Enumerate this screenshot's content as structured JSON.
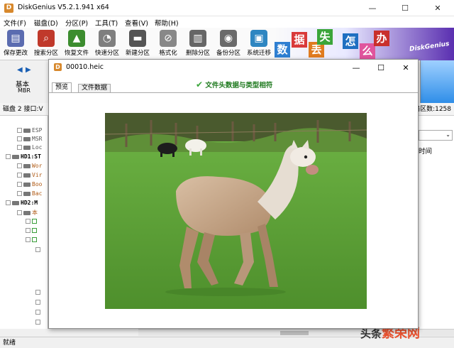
{
  "app": {
    "logo_text": "D",
    "title": "DiskGenius V5.2.1.941 x64",
    "minimize": "—",
    "maximize": "☐",
    "close": "✕"
  },
  "menu": [
    "文件(F)",
    "磁盘(D)",
    "分区(P)",
    "工具(T)",
    "查看(V)",
    "帮助(H)"
  ],
  "toolbar": [
    {
      "label": "保存更改",
      "icon": "save-icon",
      "color": "#5b6cb0",
      "glyph": "▤"
    },
    {
      "label": "搜索分区",
      "icon": "search-icon",
      "color": "#c0392b",
      "glyph": "⌕"
    },
    {
      "label": "恢复文件",
      "icon": "recover-icon",
      "color": "#3c8d2f",
      "glyph": "▲"
    },
    {
      "label": "快速分区",
      "icon": "quick-partition-icon",
      "color": "#7f7f7f",
      "glyph": "◔"
    },
    {
      "label": "新建分区",
      "icon": "new-partition-icon",
      "color": "#555555",
      "glyph": "▬"
    },
    {
      "label": "格式化",
      "icon": "format-icon",
      "color": "#888888",
      "glyph": "⊘"
    },
    {
      "label": "删除分区",
      "icon": "delete-icon",
      "color": "#666666",
      "glyph": "▥"
    },
    {
      "label": "备份分区",
      "icon": "backup-icon",
      "color": "#6a6a6a",
      "glyph": "◉"
    },
    {
      "label": "系统迁移",
      "icon": "migrate-icon",
      "color": "#2e86c1",
      "glyph": "▣"
    }
  ],
  "banner": {
    "tiles": [
      "数",
      "据",
      "丢",
      "失",
      "怎",
      "么",
      "办"
    ],
    "brand": "DiskGenius"
  },
  "disk_nav": {
    "prev": "◀",
    "next": "▶",
    "basic": "基本",
    "mbr": "MBR"
  },
  "diskline": {
    "left": "磁盘 2 接口:V",
    "right": "扇区数:1258"
  },
  "tree": [
    {
      "text": "ESP",
      "kind": "disk"
    },
    {
      "text": "MSR",
      "kind": "disk"
    },
    {
      "text": "Loc",
      "kind": "disk"
    },
    {
      "text": "HD1:ST",
      "kind": "root"
    },
    {
      "text": "Wor",
      "kind": "disk"
    },
    {
      "text": "Vir",
      "kind": "disk"
    },
    {
      "text": "Boo",
      "kind": "disk"
    },
    {
      "text": "Bac",
      "kind": "disk"
    },
    {
      "text": "HD2:M",
      "kind": "root"
    },
    {
      "text": "本",
      "kind": "disk"
    }
  ],
  "right_panel": {
    "combo_arrow": "⌄",
    "column": "时间"
  },
  "dialog": {
    "icon": "D",
    "filename": "00010.heic",
    "minimize": "—",
    "maximize": "☐",
    "close": "✕",
    "tabs": [
      "预览",
      "文件数据"
    ],
    "signature": "文件头数据与类型相符"
  },
  "status": "就绪",
  "watermark": {
    "prefix": "头条",
    "brand": "繁荣网"
  },
  "colors": {
    "accent": "#2e86c1",
    "grass": "#5fa33a",
    "alpaca": "#c9a88a"
  }
}
